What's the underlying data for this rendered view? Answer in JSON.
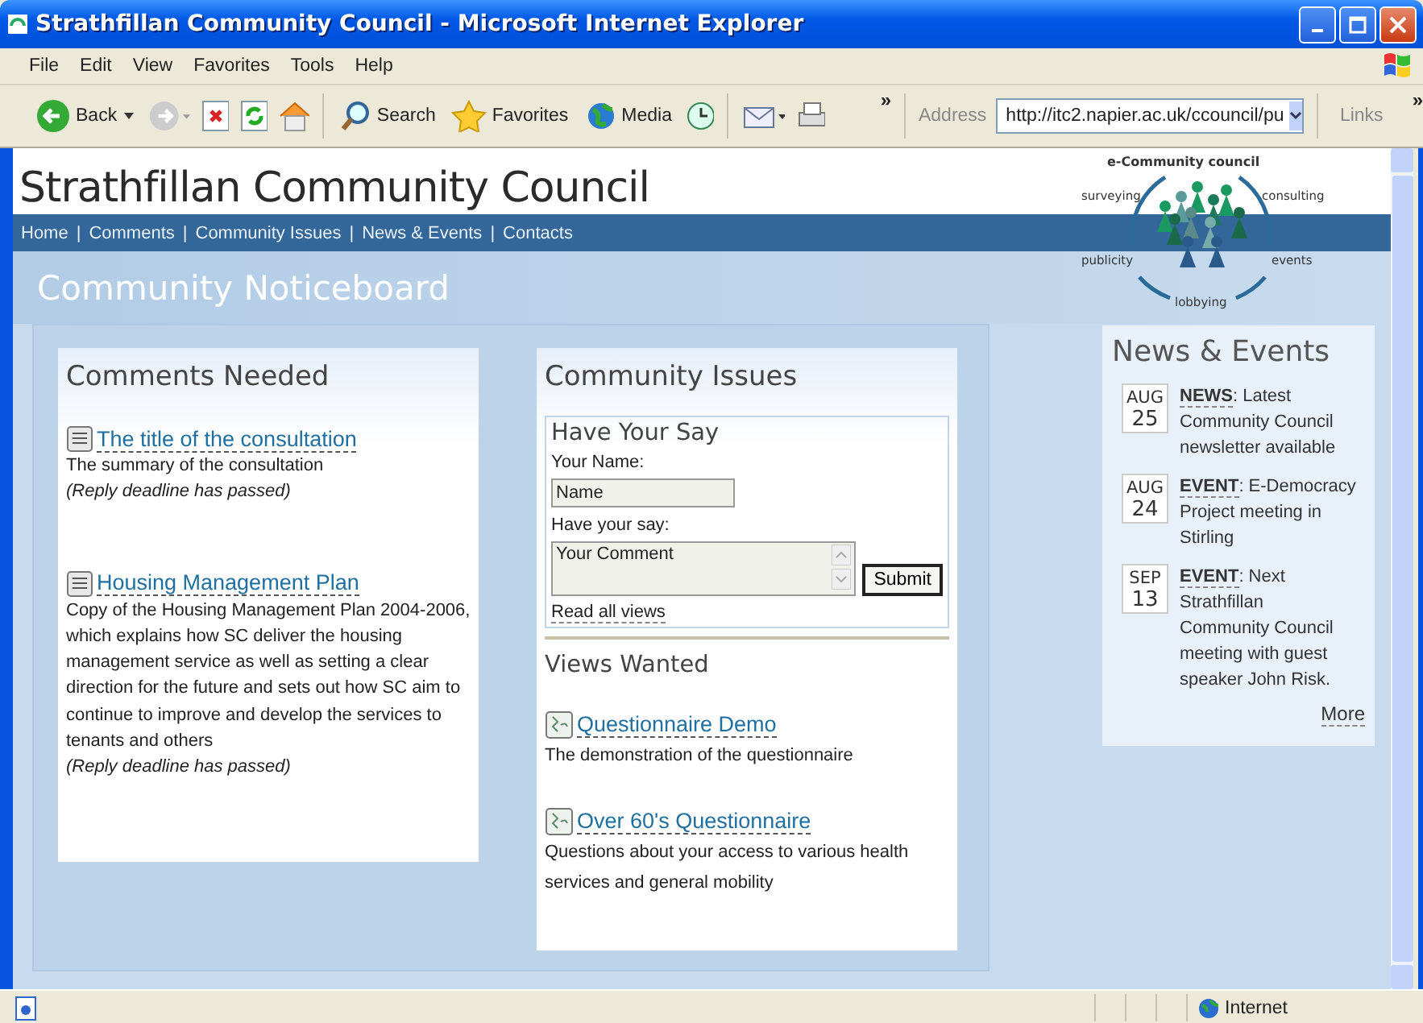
{
  "window": {
    "title": "Strathfillan Community Council - Microsoft Internet Explorer"
  },
  "menu": [
    "File",
    "Edit",
    "View",
    "Favorites",
    "Tools",
    "Help"
  ],
  "toolbar": {
    "back": "Back",
    "buttons": [
      {
        "label": "Search",
        "kind": "search"
      },
      {
        "label": "Favorites",
        "kind": "favorites"
      },
      {
        "label": "Media",
        "kind": "media"
      }
    ],
    "chevron": "»",
    "address_label": "Address",
    "url": "http://itc2.napier.ac.uk/ccouncil/pu",
    "links": "Links",
    "links_chevron": "»"
  },
  "site": {
    "title": "Strathfillan Community Council",
    "nav": [
      "Home",
      "Comments",
      "Community Issues",
      "News & Events",
      "Contacts"
    ],
    "nav_separator": "|",
    "logo": {
      "title": "e-Community council",
      "labels": [
        "surveying",
        "consulting",
        "publicity",
        "events",
        "lobbying"
      ]
    },
    "heading": "Community Noticeboard"
  },
  "comments": {
    "title": "Comments Needed",
    "items": [
      {
        "title": "The title of the consultation",
        "summary": "The summary of the consultation",
        "deadline": "(Reply deadline has passed)"
      },
      {
        "title": "Housing Management Plan",
        "summary": "Copy of the Housing Management Plan 2004-2006, which explains how SC deliver the housing management service as well as setting a clear direction for the future and sets out how SC aim to continue to improve and develop the services to tenants and others",
        "deadline": "(Reply deadline has passed)"
      }
    ]
  },
  "issues": {
    "title": "Community Issues",
    "form": {
      "title": "Have Your Say",
      "name_label": "Your Name:",
      "name_value": "Name",
      "say_label": "Have your say:",
      "comment_value": "Your Comment",
      "submit": "Submit",
      "read_all": "Read all views"
    },
    "views_title": "Views Wanted",
    "views": [
      {
        "title": "Questionnaire Demo",
        "summary": "The demonstration of the questionnaire"
      },
      {
        "title": "Over 60's Questionnaire",
        "summary": "Questions about your access to various health services and general mobility"
      }
    ]
  },
  "news": {
    "title": "News & Events",
    "items": [
      {
        "month": "AUG",
        "day": "25",
        "type": "NEWS",
        "text": ": Latest Community Council newsletter available"
      },
      {
        "month": "AUG",
        "day": "24",
        "type": "EVENT",
        "text": ": E-Democracy Project meeting in Stirling"
      },
      {
        "month": "SEP",
        "day": "13",
        "type": "EVENT",
        "text": ": Next Strathfillan Community Council meeting with guest speaker John Risk."
      }
    ],
    "more": "More"
  },
  "status": {
    "zone": "Internet"
  }
}
